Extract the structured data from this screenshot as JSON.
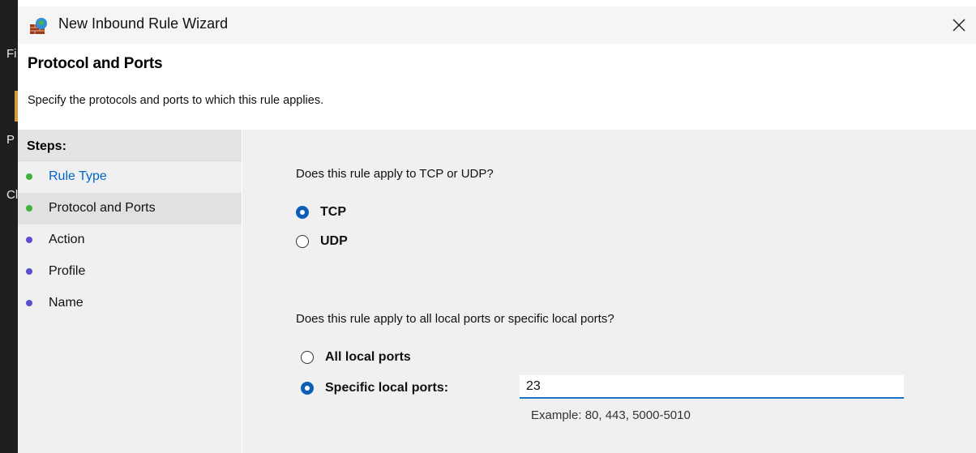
{
  "window": {
    "title": "New Inbound Rule Wizard",
    "close_glyph": "✕"
  },
  "background_app": {
    "visible_chars": [
      "Fi",
      "P",
      "Cl"
    ]
  },
  "header": {
    "title": "Protocol and Ports",
    "description": "Specify the protocols and ports to which this rule applies."
  },
  "steps": {
    "heading": "Steps:",
    "items": [
      {
        "label": "Rule Type",
        "bullet_color": "#3fb13f",
        "state": "link"
      },
      {
        "label": "Protocol and Ports",
        "bullet_color": "#3fb13f",
        "state": "current"
      },
      {
        "label": "Action",
        "bullet_color": "#5a4fcf",
        "state": "pending"
      },
      {
        "label": "Profile",
        "bullet_color": "#5a4fcf",
        "state": "pending"
      },
      {
        "label": "Name",
        "bullet_color": "#5a4fcf",
        "state": "pending"
      }
    ]
  },
  "protocol": {
    "question": "Does this rule apply to TCP or UDP?",
    "options": [
      {
        "label": "TCP",
        "checked": true
      },
      {
        "label": "UDP",
        "checked": false
      }
    ]
  },
  "ports": {
    "question": "Does this rule apply to all local ports or specific local ports?",
    "options": [
      {
        "label": "All local ports",
        "checked": false
      },
      {
        "label": "Specific local ports:",
        "checked": true
      }
    ],
    "value": "23",
    "example": "Example: 80, 443, 5000-5010"
  },
  "colors": {
    "accent": "#0c5fb8",
    "link": "#0066cc",
    "input_underline": "#1a73c8"
  }
}
